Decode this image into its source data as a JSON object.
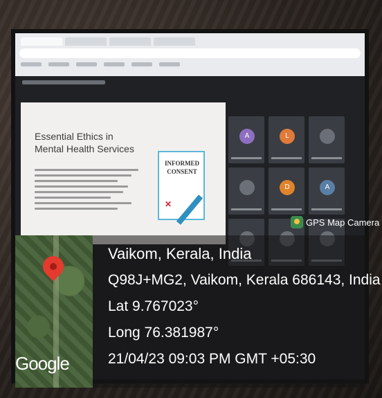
{
  "slide": {
    "title": "Essential Ethics in\nMental Health Services",
    "card_text": "INFORMED\nCONSENT"
  },
  "gps": {
    "badge_label": "GPS Map Camera",
    "place": "Vaikom, Kerala, India",
    "address": "Q98J+MG2, Vaikom, Kerala 686143, India",
    "lat": "Lat 9.767023°",
    "long": "Long 76.381987°",
    "datetime": "21/04/23 09:03 PM GMT +05:30",
    "map_brand": "Google"
  },
  "tiles": [
    {
      "initial": "A",
      "color": "#8e6fbf"
    },
    {
      "initial": "L",
      "color": "#e07a3a"
    },
    {
      "initial": "",
      "color": "#6b7078"
    },
    {
      "initial": "",
      "color": "#6b7078"
    },
    {
      "initial": "D",
      "color": "#e0842c"
    },
    {
      "initial": "A",
      "color": "#5a7fa6"
    },
    {
      "initial": "",
      "color": "#6b7078"
    },
    {
      "initial": "",
      "color": "#6b7078"
    },
    {
      "initial": "",
      "color": "#6b7078"
    }
  ],
  "colors": {
    "pin": "#e53a2e",
    "card_border": "#5ab7d8"
  }
}
